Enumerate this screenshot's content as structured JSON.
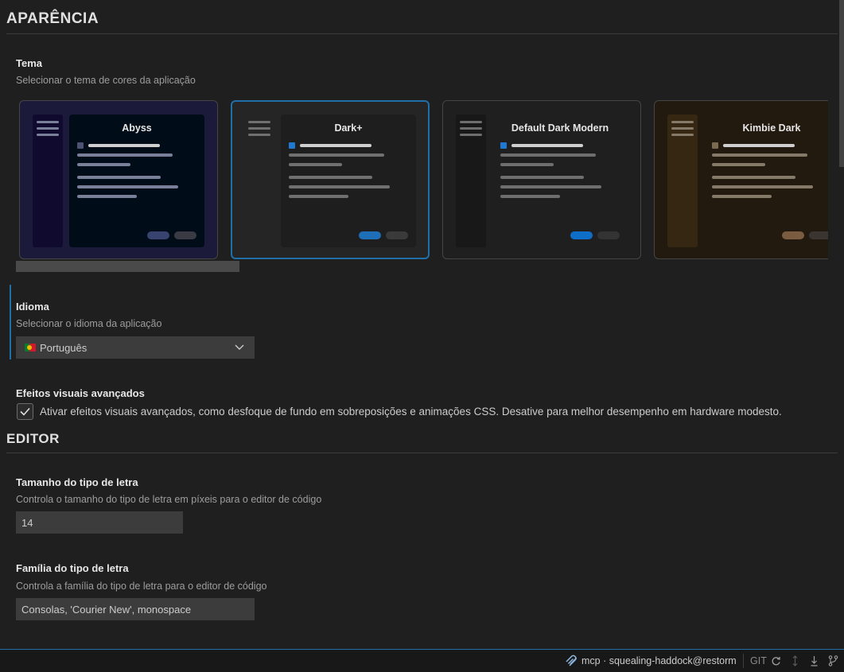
{
  "appearance": {
    "section_title": "APARÊNCIA",
    "theme": {
      "title": "Tema",
      "description": "Selecionar o tema de cores da aplicação",
      "selected": "Dark+",
      "cards": [
        {
          "name": "Abyss",
          "selected": false,
          "colors": {
            "bg": "#000c18",
            "outer": "#1b1a3a",
            "sidebar": "#0f0a2e",
            "main": "#000c18",
            "text": "#e6e6e6",
            "line": "#7a7f99",
            "dot": "#4d5272",
            "pill1": "#384370",
            "pill2": "#3a3a44"
          }
        },
        {
          "name": "Dark+",
          "selected": true,
          "colors": {
            "bg": "#1e1e1e",
            "outer": "#252526",
            "sidebar": "#252526",
            "main": "#1e1e1e",
            "text": "#e6e6e6",
            "line": "#707070",
            "dot": "#1f78d1",
            "pill1": "#1f6fb8",
            "pill2": "#3a3a3a"
          }
        },
        {
          "name": "Default Dark Modern",
          "selected": false,
          "colors": {
            "bg": "#1f1f1f",
            "outer": "#1f1f1f",
            "sidebar": "#181818",
            "main": "#1f1f1f",
            "text": "#e6e6e6",
            "line": "#6e6e6e",
            "dot": "#1f78d1",
            "pill1": "#0f6fc8",
            "pill2": "#333333"
          }
        },
        {
          "name": "Kimbie Dark",
          "selected": false,
          "colors": {
            "bg": "#221a0f",
            "outer": "#221a0f",
            "sidebar": "#362712",
            "main": "#221a0f",
            "text": "#e6e6e6",
            "line": "#857a68",
            "dot": "#7a6a4e",
            "pill1": "#7a5d40",
            "pill2": "#3a3530"
          }
        }
      ]
    },
    "language": {
      "title": "Idioma",
      "description": "Selecionar o idioma da aplicação",
      "value": "Português"
    },
    "effects": {
      "title": "Efeitos visuais avançados",
      "checked": true,
      "label": "Ativar efeitos visuais avançados, como desfoque de fundo em sobreposições e animações CSS. Desative para melhor desempenho em hardware modesto."
    }
  },
  "editor": {
    "section_title": "EDITOR",
    "font_size": {
      "title": "Tamanho do tipo de letra",
      "description": "Controla o tamanho do tipo de letra em píxeis para o editor de código",
      "value": "14"
    },
    "font_family": {
      "title": "Família do tipo de letra",
      "description": "Controla a família do tipo de letra para o editor de código",
      "value": "Consolas, 'Courier New', monospace"
    }
  },
  "statusbar": {
    "connection": "mcp · squealing-haddock@restorm",
    "git_label": "GIT",
    "icons": [
      "mcp-icon",
      "refresh-icon",
      "push-pull-icon",
      "download-icon",
      "branch-icon"
    ]
  },
  "colors": {
    "accent": "#1f6fa8",
    "background": "#1f1f1f"
  }
}
